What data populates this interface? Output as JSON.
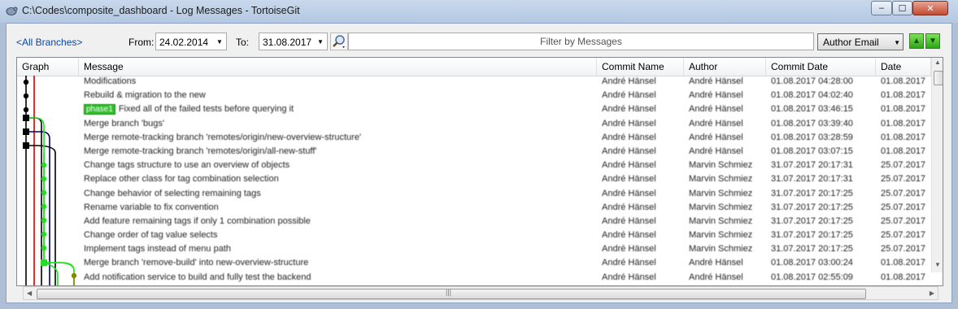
{
  "window": {
    "title": "C:\\Codes\\composite_dashboard - Log Messages - TortoiseGit",
    "controls": {
      "minimize": "–",
      "maximize": "☐",
      "close": "✕"
    }
  },
  "toolbar": {
    "branches_link": "<All Branches>",
    "from_label": "From:",
    "from_value": "24.02.2014",
    "to_label": "To:",
    "to_value": "31.08.2017",
    "filter_placeholder": "Filter by Messages",
    "filter_field": "Author Email",
    "icons": {
      "search": "magnifier-icon",
      "up": "arrow-up-icon",
      "down": "arrow-down-icon"
    }
  },
  "table": {
    "columns": [
      "Graph",
      "Message",
      "Commit Name",
      "Author",
      "Commit Date",
      "Date"
    ],
    "rows": [
      {
        "message": "Modifications",
        "commit_name": "André Hänsel",
        "author": "André Hänsel",
        "commit_date": "01.08.2017 04:28:00",
        "date": "01.08.2017"
      },
      {
        "message": "Rebuild & migration to the new",
        "commit_name": "André Hänsel",
        "author": "André Hänsel",
        "commit_date": "01.08.2017 04:02:40",
        "date": "01.08.2017"
      },
      {
        "tag": "phase1",
        "message": "Fixed all of the failed tests before querying it",
        "commit_name": "André Hänsel",
        "author": "André Hänsel",
        "commit_date": "01.08.2017 03:46:15",
        "date": "01.08.2017"
      },
      {
        "message": "Merge branch 'bugs'",
        "commit_name": "André Hänsel",
        "author": "André Hänsel",
        "commit_date": "01.08.2017 03:39:40",
        "date": "01.08.2017"
      },
      {
        "message": "Merge remote-tracking branch 'remotes/origin/new-overview-structure'",
        "commit_name": "André Hänsel",
        "author": "André Hänsel",
        "commit_date": "01.08.2017 03:28:59",
        "date": "01.08.2017"
      },
      {
        "message": "Merge remote-tracking branch 'remotes/origin/all-new-stuff'",
        "commit_name": "André Hänsel",
        "author": "André Hänsel",
        "commit_date": "01.08.2017 03:07:15",
        "date": "01.08.2017"
      },
      {
        "message": "Change tags structure to use an overview of objects",
        "commit_name": "André Hänsel",
        "author": "Marvin Schmiez",
        "commit_date": "31.07.2017 20:17:31",
        "date": "25.07.2017"
      },
      {
        "message": "Replace other class for tag combination selection",
        "commit_name": "André Hänsel",
        "author": "Marvin Schmiez",
        "commit_date": "31.07.2017 20:17:31",
        "date": "25.07.2017"
      },
      {
        "message": "Change behavior of selecting remaining tags",
        "commit_name": "André Hänsel",
        "author": "Marvin Schmiez",
        "commit_date": "31.07.2017 20:17:25",
        "date": "25.07.2017"
      },
      {
        "message": "Rename variable to fix convention",
        "commit_name": "André Hänsel",
        "author": "Marvin Schmiez",
        "commit_date": "31.07.2017 20:17:25",
        "date": "25.07.2017"
      },
      {
        "message": "Add feature remaining tags if only 1 combination possible",
        "commit_name": "André Hänsel",
        "author": "Marvin Schmiez",
        "commit_date": "31.07.2017 20:17:25",
        "date": "25.07.2017"
      },
      {
        "message": "Change order of tag value selects",
        "commit_name": "André Hänsel",
        "author": "Marvin Schmiez",
        "commit_date": "31.07.2017 20:17:25",
        "date": "25.07.2017"
      },
      {
        "message": "Implement tags instead of menu path",
        "commit_name": "André Hänsel",
        "author": "Marvin Schmiez",
        "commit_date": "31.07.2017 20:17:25",
        "date": "25.07.2017"
      },
      {
        "message": "Merge branch 'remove-build' into new-overview-structure",
        "commit_name": "André Hänsel",
        "author": "André Hänsel",
        "commit_date": "01.08.2017 03:00:24",
        "date": "01.08.2017"
      },
      {
        "message": "Add notification service to build and fully test the backend",
        "commit_name": "André Hänsel",
        "author": "André Hänsel",
        "commit_date": "01.08.2017 02:55:09",
        "date": "01.08.2017"
      }
    ]
  },
  "colors": {
    "branch_black": "#000000",
    "branch_red": "#cc0000",
    "branch_green": "#22dd22",
    "branch_navy": "#000066",
    "branch_olive": "#888800",
    "tag_green": "#2fbf2a"
  }
}
